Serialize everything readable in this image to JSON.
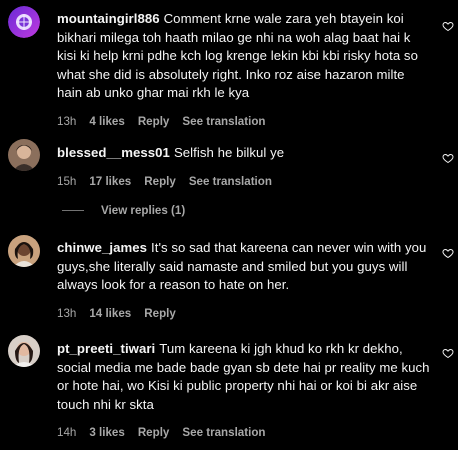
{
  "comments": [
    {
      "username": "mountaingirl886",
      "text": "Comment krne wale zara yeh btayein koi bikhari milega toh haath milao ge nhi na woh alag baat hai k kisi ki help krni pdhe kch log krenge lekin kbi kbi risky hota so what she did is absolutely right. Inko roz aise hazaron milte hain ab unko ghar mai rkh le kya",
      "time": "13h",
      "likes": "4 likes",
      "reply": "Reply",
      "translate": "See translation"
    },
    {
      "username": "blessed__mess01",
      "text": "Selfish he bilkul ye",
      "time": "15h",
      "likes": "17 likes",
      "reply": "Reply",
      "translate": "See translation",
      "view_replies": "View replies (1)"
    },
    {
      "username": "chinwe_james",
      "text": "It's so sad that kareena can never win with you guys,she literally said namaste and smiled but you guys will always look for a reason to hate on her.",
      "time": "13h",
      "likes": "14 likes",
      "reply": "Reply"
    },
    {
      "username": "pt_preeti_tiwari",
      "text": "Tum kareena ki jgh khud ko rkh kr dekho, social media me bade bade gyan sb dete hai pr reality me kuch or hote hai, wo Kisi ki public property nhi hai or koi bi akr aise touch nhi kr skta",
      "time": "14h",
      "likes": "3 likes",
      "reply": "Reply",
      "translate": "See translation"
    }
  ],
  "colors": {
    "background": "#000000",
    "text": "#f5f5f5",
    "meta": "#a8a8a8"
  },
  "icons": {
    "like": "heart-outline-icon"
  }
}
